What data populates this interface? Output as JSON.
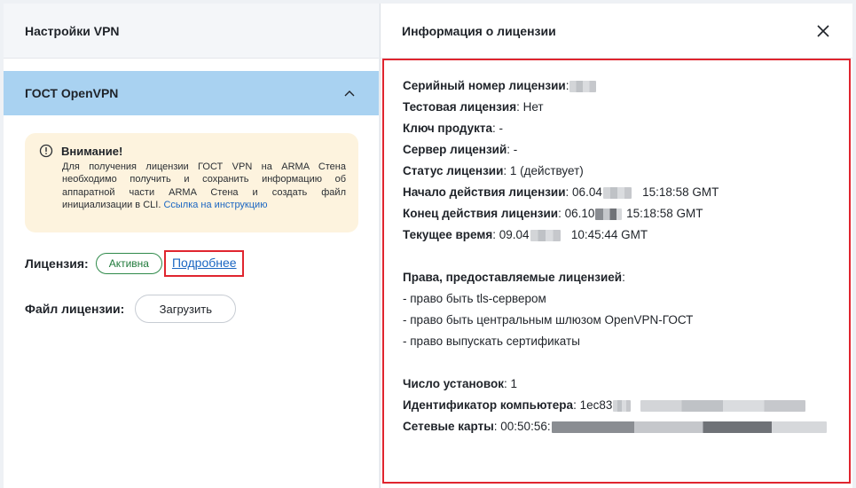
{
  "left": {
    "title": "Настройки VPN",
    "accordion_title": "ГОСТ OpenVPN",
    "warning": {
      "title": "Внимание!",
      "text": "Для получения лицензии ГОСТ VPN на ARMA Стена необходимо получить и сохранить информацию об аппаратной части ARMA Стена и создать файл инициализации в CLI.",
      "link": "Ссылка на инструкцию"
    },
    "license_label": "Лицензия:",
    "license_status": "Активна",
    "details_link": "Подробнее",
    "file_label": "Файл лицензии:",
    "upload_button": "Загрузить"
  },
  "right": {
    "title": "Информация о лицензии",
    "fields": {
      "serial_label": "Серийный номер лицензии",
      "serial_value": "",
      "test_label": "Тестовая лицензия",
      "test_value": "Нет",
      "key_label": "Ключ продукта",
      "key_value": "-",
      "server_label": "Сервер лицензий",
      "server_value": "-",
      "status_label": "Статус лицензии",
      "status_value": "1 (действует)",
      "start_label": "Начало действия лицензии",
      "start_value_a": "06.04",
      "start_value_b": "15:18:58 GMT",
      "end_label": "Конец действия лицензии",
      "end_value_a": "06.10",
      "end_value_b": "15:18:58 GMT",
      "now_label": "Текущее время",
      "now_value_a": "09.04",
      "now_value_b": "10:45:44 GMT"
    },
    "rights": {
      "title": "Права, предоставляемые лицензией",
      "items": [
        "- право быть tls-сервером",
        "- право быть центральным шлюзом OpenVPN-ГОСТ",
        "- право выпускать сертификаты"
      ]
    },
    "install": {
      "count_label": "Число установок",
      "count_value": "1",
      "computer_id_label": "Идентификатор компьютера",
      "computer_id_value": "1ec83",
      "nic_label": "Сетевые карты",
      "nic_value": "00:50:56:"
    }
  },
  "colors": {
    "accent_blue": "#a9d2f1",
    "highlight_red": "#e0252f",
    "warning_bg": "#fdf3de",
    "link": "#1a66c2",
    "status_green": "#2f8a4a"
  },
  "icons": {
    "chevron": "chevron-up-icon",
    "warning": "info-circle-icon",
    "close": "close-icon"
  }
}
